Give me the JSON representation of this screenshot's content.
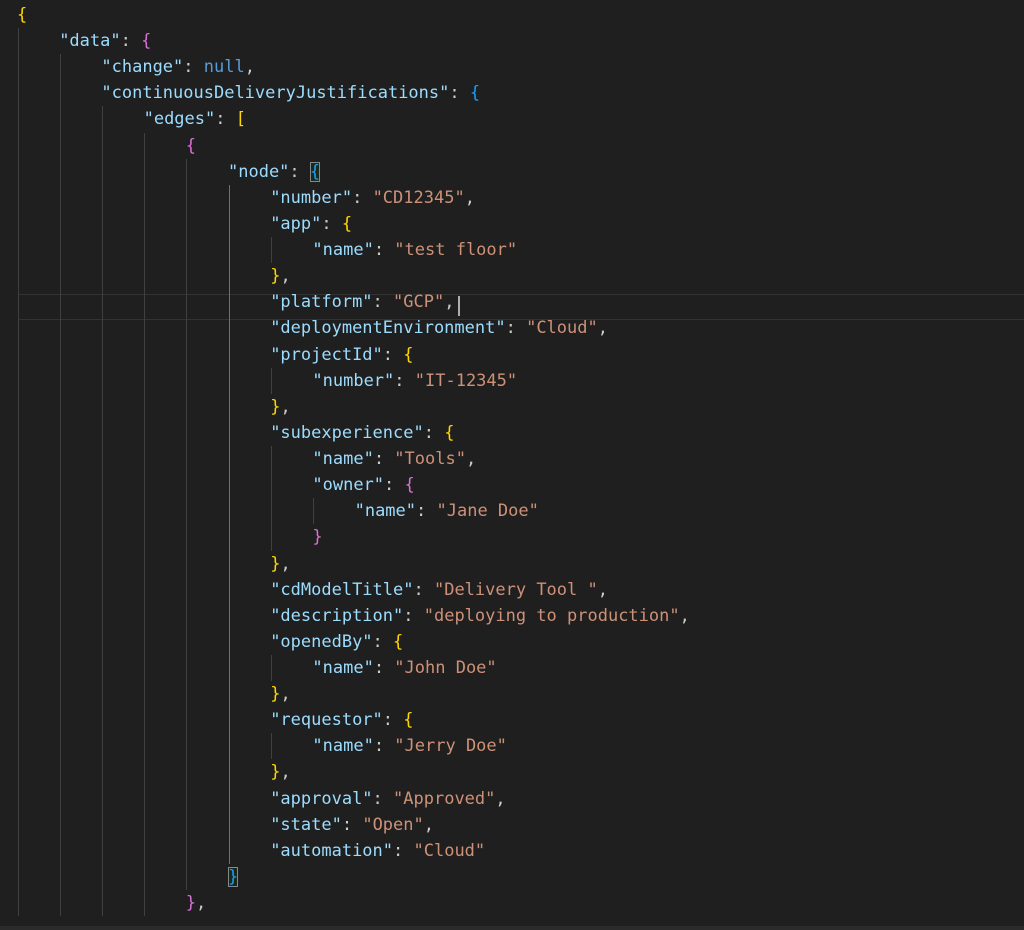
{
  "editor": {
    "lines": [
      {
        "t": [
          {
            "c": "b1",
            "v": "{"
          }
        ]
      },
      {
        "t": [
          {
            "c": "k",
            "v": "\"data\""
          },
          {
            "c": "p",
            "v": ": "
          },
          {
            "c": "b2",
            "v": "{"
          }
        ]
      },
      {
        "t": [
          {
            "c": "k",
            "v": "\"change\""
          },
          {
            "c": "p",
            "v": ": "
          },
          {
            "c": "n",
            "v": "null"
          },
          {
            "c": "p",
            "v": ","
          }
        ]
      },
      {
        "t": [
          {
            "c": "k",
            "v": "\"continuousDeliveryJustifications\""
          },
          {
            "c": "p",
            "v": ": "
          },
          {
            "c": "b3",
            "v": "{"
          }
        ]
      },
      {
        "t": [
          {
            "c": "k",
            "v": "\"edges\""
          },
          {
            "c": "p",
            "v": ": "
          },
          {
            "c": "b1",
            "v": "["
          }
        ]
      },
      {
        "t": [
          {
            "c": "b2",
            "v": "{"
          }
        ]
      },
      {
        "t": [
          {
            "c": "k",
            "v": "\"node\""
          },
          {
            "c": "p",
            "v": ": "
          },
          {
            "c": "b3 match",
            "v": "{"
          }
        ]
      },
      {
        "t": [
          {
            "c": "k",
            "v": "\"number\""
          },
          {
            "c": "p",
            "v": ": "
          },
          {
            "c": "s",
            "v": "\"CD12345\""
          },
          {
            "c": "p",
            "v": ","
          }
        ]
      },
      {
        "t": [
          {
            "c": "k",
            "v": "\"app\""
          },
          {
            "c": "p",
            "v": ": "
          },
          {
            "c": "b1",
            "v": "{"
          }
        ]
      },
      {
        "t": [
          {
            "c": "k",
            "v": "\"name\""
          },
          {
            "c": "p",
            "v": ": "
          },
          {
            "c": "s",
            "v": "\"test floor\""
          }
        ]
      },
      {
        "t": [
          {
            "c": "b1",
            "v": "}"
          },
          {
            "c": "p",
            "v": ","
          }
        ]
      },
      {
        "t": [
          {
            "c": "k",
            "v": "\"platform\""
          },
          {
            "c": "p",
            "v": ": "
          },
          {
            "c": "s",
            "v": "\"GCP\""
          },
          {
            "c": "p",
            "v": ","
          }
        ]
      },
      {
        "t": [
          {
            "c": "k",
            "v": "\"deploymentEnvironment\""
          },
          {
            "c": "p",
            "v": ": "
          },
          {
            "c": "s",
            "v": "\"Cloud\""
          },
          {
            "c": "p",
            "v": ","
          }
        ]
      },
      {
        "t": [
          {
            "c": "k",
            "v": "\"projectId\""
          },
          {
            "c": "p",
            "v": ": "
          },
          {
            "c": "b1",
            "v": "{"
          }
        ]
      },
      {
        "t": [
          {
            "c": "k",
            "v": "\"number\""
          },
          {
            "c": "p",
            "v": ": "
          },
          {
            "c": "s",
            "v": "\"IT-12345\""
          }
        ]
      },
      {
        "t": [
          {
            "c": "b1",
            "v": "}"
          },
          {
            "c": "p",
            "v": ","
          }
        ]
      },
      {
        "t": [
          {
            "c": "k",
            "v": "\"subexperience\""
          },
          {
            "c": "p",
            "v": ": "
          },
          {
            "c": "b1",
            "v": "{"
          }
        ]
      },
      {
        "t": [
          {
            "c": "k",
            "v": "\"name\""
          },
          {
            "c": "p",
            "v": ": "
          },
          {
            "c": "s",
            "v": "\"Tools\""
          },
          {
            "c": "p",
            "v": ","
          }
        ]
      },
      {
        "t": [
          {
            "c": "k",
            "v": "\"owner\""
          },
          {
            "c": "p",
            "v": ": "
          },
          {
            "c": "b2",
            "v": "{"
          }
        ]
      },
      {
        "t": [
          {
            "c": "k",
            "v": "\"name\""
          },
          {
            "c": "p",
            "v": ": "
          },
          {
            "c": "s",
            "v": "\"Jane Doe\""
          }
        ]
      },
      {
        "t": [
          {
            "c": "b2",
            "v": "}"
          }
        ]
      },
      {
        "t": [
          {
            "c": "b1",
            "v": "}"
          },
          {
            "c": "p",
            "v": ","
          }
        ]
      },
      {
        "t": [
          {
            "c": "k",
            "v": "\"cdModelTitle\""
          },
          {
            "c": "p",
            "v": ": "
          },
          {
            "c": "s",
            "v": "\"Delivery Tool \""
          },
          {
            "c": "p",
            "v": ","
          }
        ]
      },
      {
        "t": [
          {
            "c": "k",
            "v": "\"description\""
          },
          {
            "c": "p",
            "v": ": "
          },
          {
            "c": "s",
            "v": "\"deploying to production\""
          },
          {
            "c": "p",
            "v": ","
          }
        ]
      },
      {
        "t": [
          {
            "c": "k",
            "v": "\"openedBy\""
          },
          {
            "c": "p",
            "v": ": "
          },
          {
            "c": "b1",
            "v": "{"
          }
        ]
      },
      {
        "t": [
          {
            "c": "k",
            "v": "\"name\""
          },
          {
            "c": "p",
            "v": ": "
          },
          {
            "c": "s",
            "v": "\"John Doe\""
          }
        ]
      },
      {
        "t": [
          {
            "c": "b1",
            "v": "}"
          },
          {
            "c": "p",
            "v": ","
          }
        ]
      },
      {
        "t": [
          {
            "c": "k",
            "v": "\"requestor\""
          },
          {
            "c": "p",
            "v": ": "
          },
          {
            "c": "b1",
            "v": "{"
          }
        ]
      },
      {
        "t": [
          {
            "c": "k",
            "v": "\"name\""
          },
          {
            "c": "p",
            "v": ": "
          },
          {
            "c": "s",
            "v": "\"Jerry Doe\""
          }
        ]
      },
      {
        "t": [
          {
            "c": "b1",
            "v": "}"
          },
          {
            "c": "p",
            "v": ","
          }
        ]
      },
      {
        "t": [
          {
            "c": "k",
            "v": "\"approval\""
          },
          {
            "c": "p",
            "v": ": "
          },
          {
            "c": "s",
            "v": "\"Approved\""
          },
          {
            "c": "p",
            "v": ","
          }
        ]
      },
      {
        "t": [
          {
            "c": "k",
            "v": "\"state\""
          },
          {
            "c": "p",
            "v": ": "
          },
          {
            "c": "s",
            "v": "\"Open\""
          },
          {
            "c": "p",
            "v": ","
          }
        ]
      },
      {
        "t": [
          {
            "c": "k",
            "v": "\"automation\""
          },
          {
            "c": "p",
            "v": ": "
          },
          {
            "c": "s",
            "v": "\"Cloud\""
          }
        ]
      },
      {
        "t": [
          {
            "c": "b3 match",
            "v": "}"
          }
        ]
      },
      {
        "t": [
          {
            "c": "b2",
            "v": "}"
          },
          {
            "c": "p",
            "v": ","
          }
        ]
      }
    ]
  },
  "colors": {
    "background": "#1f1f1f",
    "key": "#9cdcfe",
    "string": "#ce9178",
    "keyword": "#569cd6",
    "bracket_gold": "#ffd700",
    "bracket_orchid": "#da70d6",
    "bracket_blue": "#179fff"
  }
}
